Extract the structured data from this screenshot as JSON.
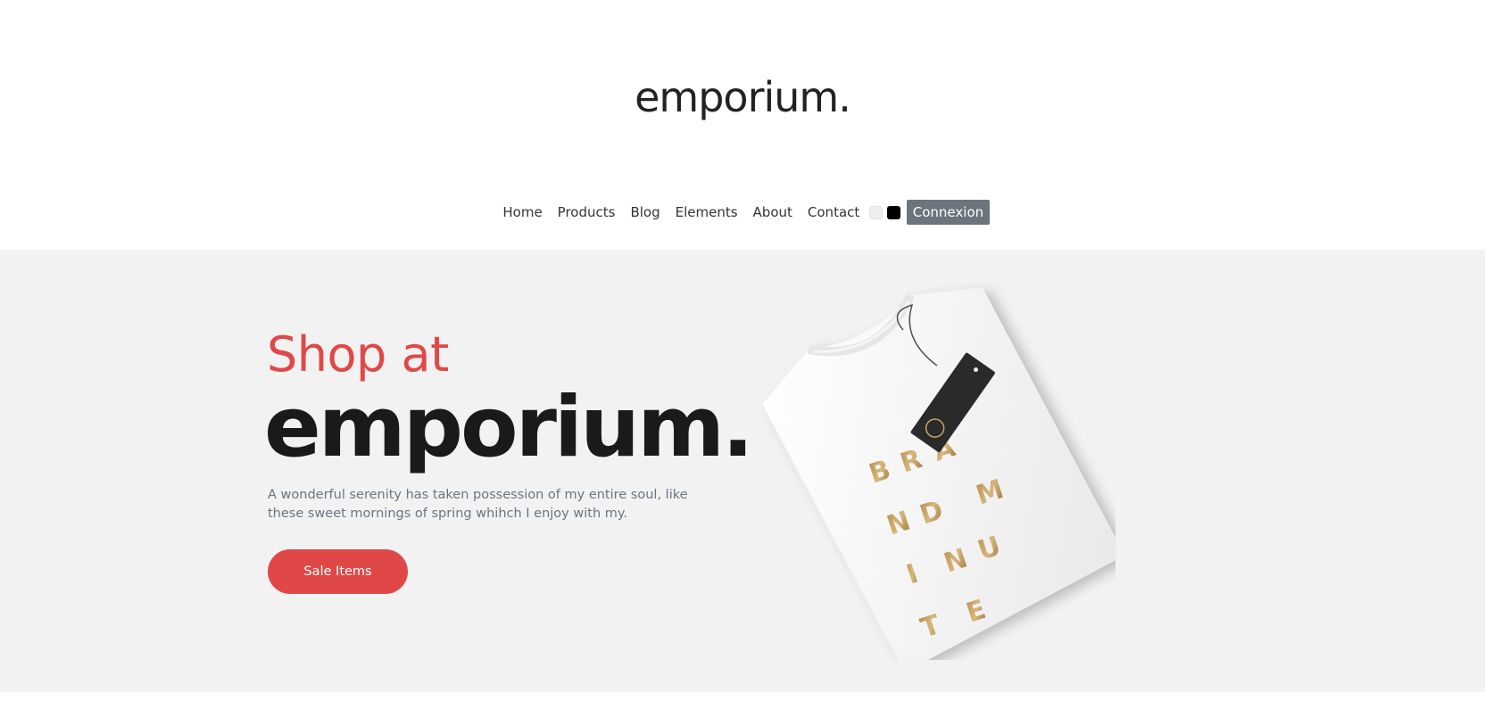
{
  "site": {
    "logo": "emporium."
  },
  "nav": {
    "items": [
      {
        "label": "Home"
      },
      {
        "label": "Products"
      },
      {
        "label": "Blog"
      },
      {
        "label": "Elements"
      },
      {
        "label": "About"
      },
      {
        "label": "Contact"
      }
    ],
    "connexion_label": "Connexion"
  },
  "hero": {
    "subtitle": "Shop at",
    "title": "emporium.",
    "description": "A wonderful serenity has taken possession of my entire soul, like these sweet mornings of spring whihch I enjoy with my.",
    "cta_label": "Sale Items"
  },
  "colors": {
    "accent": "#e04848",
    "button_gray": "#6c757d",
    "hero_bg": "#f2f2f2",
    "gold": "#c9a467"
  },
  "icons": {
    "light_theme": "light-theme-swatch-icon",
    "dark_theme": "dark-theme-swatch-icon"
  }
}
